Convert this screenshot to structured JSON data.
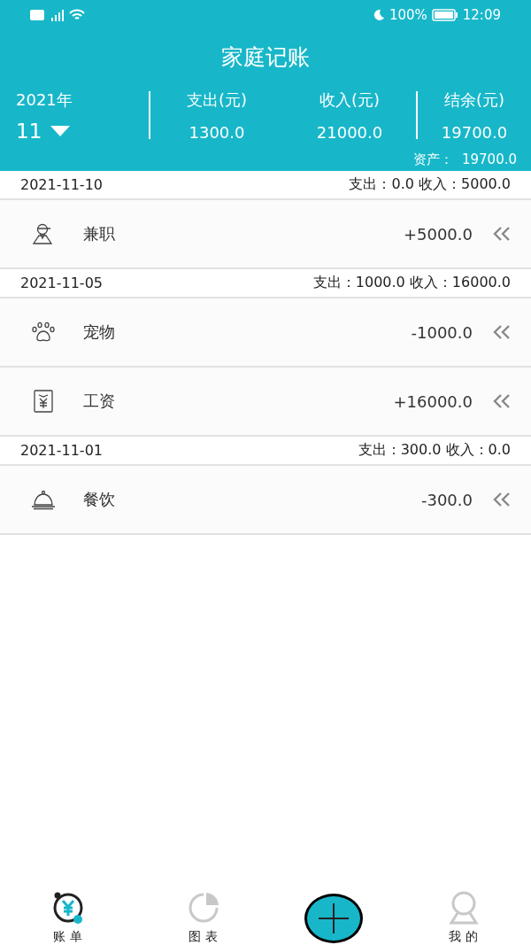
{
  "status_bar": {
    "time": "12:09",
    "battery": "100%"
  },
  "title": "家庭记账",
  "summary": {
    "year": "2021年",
    "month": "11",
    "columns": [
      {
        "label": "支出(元)",
        "value": "1300.0"
      },
      {
        "label": "收入(元)",
        "value": "21000.0"
      },
      {
        "label": "结余(元)",
        "value": "19700.0"
      }
    ],
    "assets_label": "资产：",
    "assets_value": "19700.0"
  },
  "days": [
    {
      "date": "2021-11-10",
      "totals": "支出：0.0 收入：5000.0",
      "entries": [
        {
          "kind": "parttime",
          "category": "兼职",
          "amount": "+5000.0"
        }
      ]
    },
    {
      "date": "2021-11-05",
      "totals": "支出：1000.0 收入：16000.0",
      "entries": [
        {
          "kind": "pet",
          "category": "宠物",
          "amount": "-1000.0"
        },
        {
          "kind": "salary",
          "category": "工资",
          "amount": "+16000.0"
        }
      ]
    },
    {
      "date": "2021-11-01",
      "totals": "支出：300.0 收入：0.0",
      "entries": [
        {
          "kind": "dining",
          "category": "餐饮",
          "amount": "-300.0"
        }
      ]
    }
  ],
  "tabs": [
    {
      "kind": "bills",
      "label": "账 单",
      "selected": true
    },
    {
      "kind": "chart",
      "label": "图 表",
      "selected": false
    },
    {
      "kind": "add",
      "selected": false
    },
    {
      "kind": "mine",
      "label": "我 的",
      "selected": false
    }
  ]
}
